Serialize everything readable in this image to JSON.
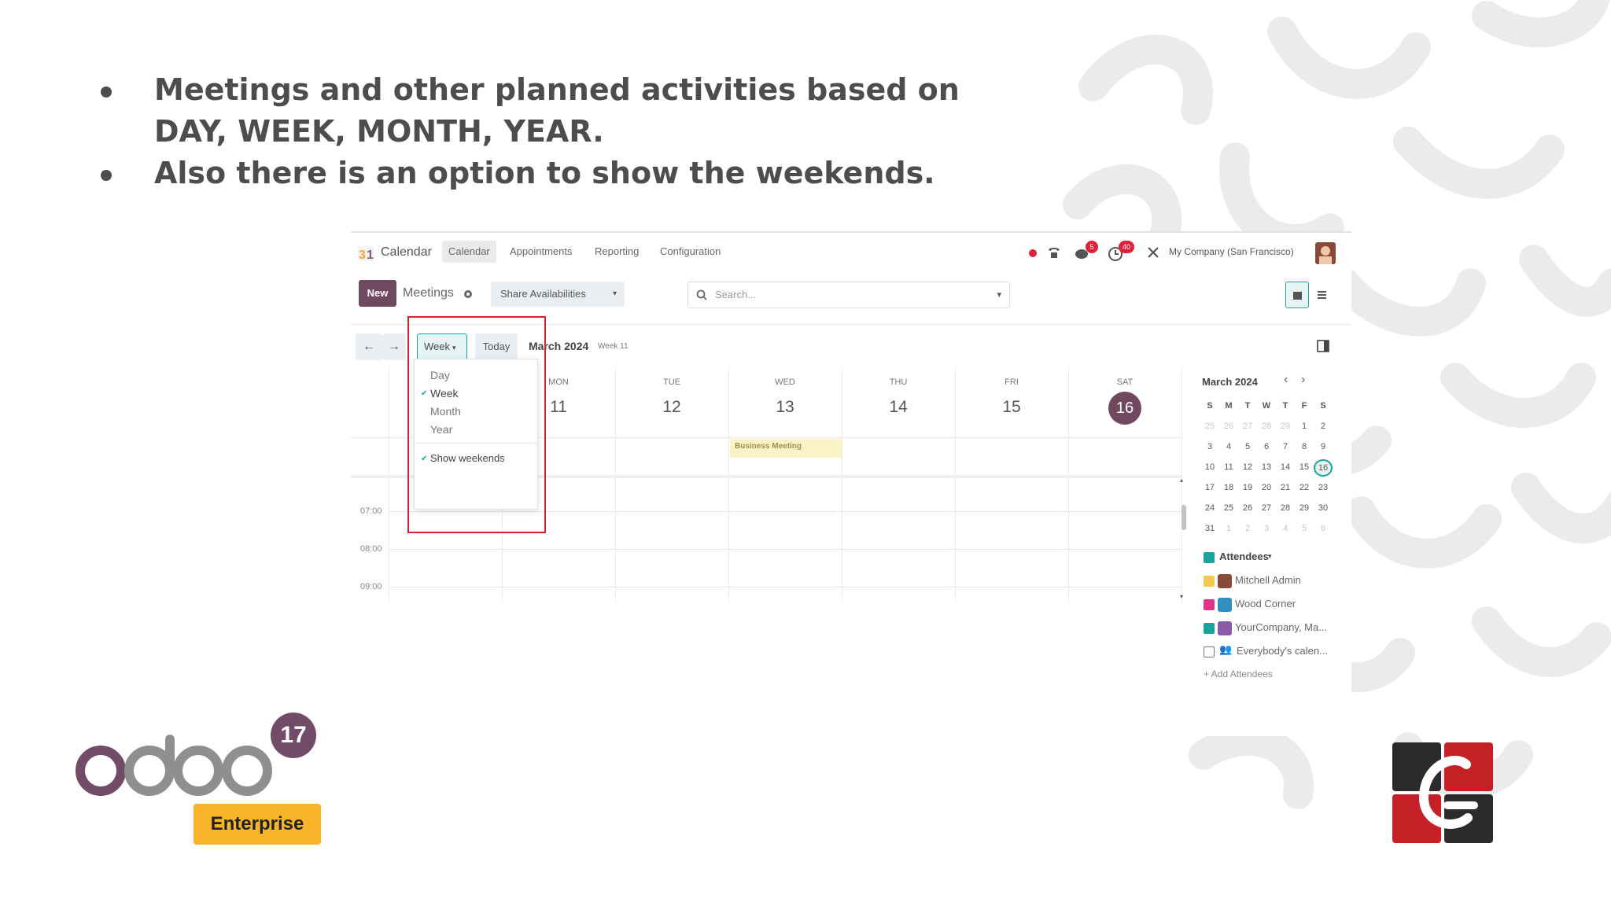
{
  "slide": {
    "bullets": [
      "Meetings and other planned activities based on DAY, WEEK, MONTH, YEAR.",
      "Also there is an option to show the weekends."
    ]
  },
  "navbar": {
    "app_name": "Calendar",
    "menu": [
      "Calendar",
      "Appointments",
      "Reporting",
      "Configuration"
    ],
    "company": "My Company (San Francisco)",
    "badges": {
      "messages": "5",
      "activities": "40"
    }
  },
  "control": {
    "new_label": "New",
    "breadcrumb": "Meetings",
    "share_label": "Share Availabilities",
    "search_placeholder": "Search..."
  },
  "calendar": {
    "scale_label": "Week",
    "today_label": "Today",
    "period": "March 2024",
    "week_label": "Week 11",
    "days": [
      {
        "name": "MON",
        "num": "11"
      },
      {
        "name": "TUE",
        "num": "12"
      },
      {
        "name": "WED",
        "num": "13"
      },
      {
        "name": "THU",
        "num": "14"
      },
      {
        "name": "FRI",
        "num": "15"
      },
      {
        "name": "SAT",
        "num": "16"
      }
    ],
    "event": "Business Meeting",
    "times": [
      "07:00",
      "08:00",
      "09:00"
    ]
  },
  "scale_menu": {
    "items": [
      "Day",
      "Week",
      "Month",
      "Year"
    ],
    "selected": "Week",
    "show_weekends": "Show weekends"
  },
  "mini_calendar": {
    "title": "March 2024",
    "weekdays": [
      "S",
      "M",
      "T",
      "W",
      "T",
      "F",
      "S"
    ],
    "weeks": [
      [
        "25",
        "26",
        "27",
        "28",
        "29",
        "1",
        "2"
      ],
      [
        "3",
        "4",
        "5",
        "6",
        "7",
        "8",
        "9"
      ],
      [
        "10",
        "11",
        "12",
        "13",
        "14",
        "15",
        "16"
      ],
      [
        "17",
        "18",
        "19",
        "20",
        "21",
        "22",
        "23"
      ],
      [
        "24",
        "25",
        "26",
        "27",
        "28",
        "29",
        "30"
      ],
      [
        "31",
        "1",
        "2",
        "3",
        "4",
        "5",
        "6"
      ]
    ],
    "today": "16"
  },
  "attendees": {
    "title": "Attendees",
    "items": [
      {
        "name": "Mitchell Admin",
        "color": "#f2c94c"
      },
      {
        "name": "Wood Corner",
        "color": "#e0338a"
      },
      {
        "name": "YourCompany, Ma...",
        "color": "#1aa39a"
      },
      {
        "name": "Everybody's calen...",
        "color": ""
      }
    ],
    "add_label": "+ Add Attendees"
  },
  "branding": {
    "odoo_version": "17",
    "edition": "Enterprise"
  },
  "colors": {
    "brand_purple": "#71495f",
    "highlight_red": "#d5222c",
    "event_bg": "#fbf3c8",
    "enterprise_badge": "#f8b52a"
  }
}
